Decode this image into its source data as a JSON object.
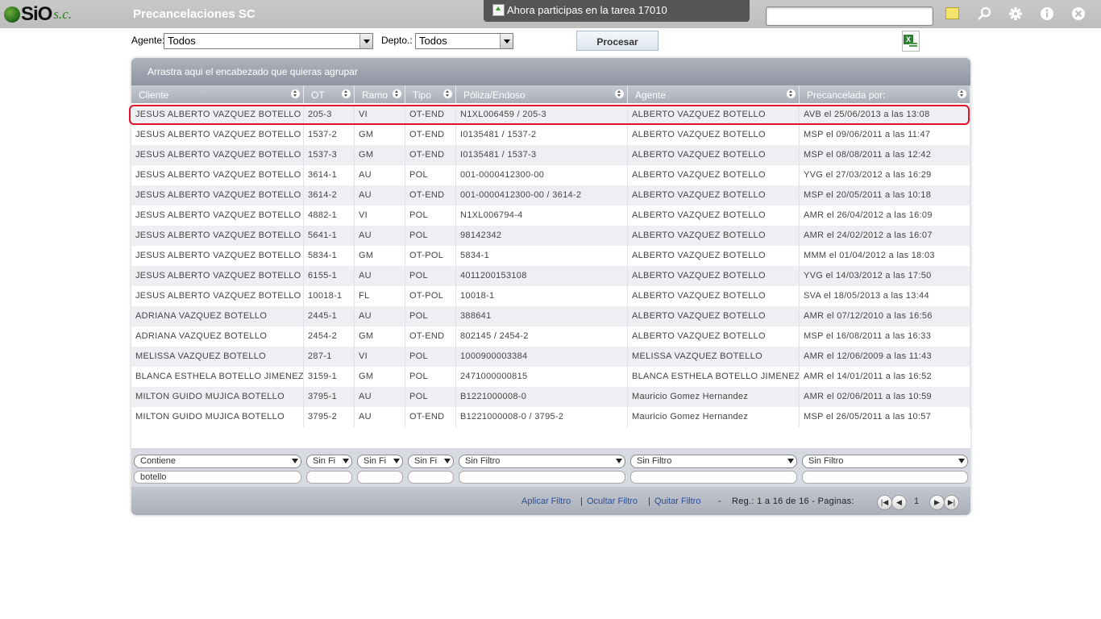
{
  "app": {
    "logo_text": "SiO",
    "logo_suffix": "s.c.",
    "title": "Precancelaciones SC",
    "notification": "Ahora participas en la tarea 17010",
    "search_placeholder": ""
  },
  "icons": [
    "note-icon",
    "search-icon",
    "gear-icon",
    "info-icon",
    "close-icon"
  ],
  "filters": {
    "agente_label": "Agente:",
    "agente_value": "Todos",
    "depto_label": "Depto.:",
    "depto_value": "Todos",
    "procesar_label": "Procesar"
  },
  "grid": {
    "group_hint": "Arrastra aqui el encabezado que quieras agrupar",
    "columns": [
      "Cliente",
      "OT",
      "Ramo",
      "Tipo",
      "Póliza/Endoso",
      "Agente",
      "Precancelada por:"
    ],
    "rows": [
      [
        "JESUS ALBERTO VAZQUEZ BOTELLO",
        "205-3",
        "VI",
        "OT-END",
        "N1XL006459 / 205-3",
        "ALBERTO VAZQUEZ BOTELLO",
        "AVB el 25/06/2013 a las 13:08"
      ],
      [
        "JESUS ALBERTO VAZQUEZ BOTELLO",
        "1537-2",
        "GM",
        "OT-END",
        "I0135481 / 1537-2",
        "ALBERTO VAZQUEZ BOTELLO",
        "MSP el 09/06/2011 a las 11:47"
      ],
      [
        "JESUS ALBERTO VAZQUEZ BOTELLO",
        "1537-3",
        "GM",
        "OT-END",
        "I0135481 / 1537-3",
        "ALBERTO VAZQUEZ BOTELLO",
        "MSP el 08/08/2011 a las 12:42"
      ],
      [
        "JESUS ALBERTO VAZQUEZ BOTELLO",
        "3614-1",
        "AU",
        "POL",
        "001-0000412300-00",
        "ALBERTO VAZQUEZ BOTELLO",
        "YVG el 27/03/2012 a las 16:29"
      ],
      [
        "JESUS ALBERTO VAZQUEZ BOTELLO",
        "3614-2",
        "AU",
        "OT-END",
        "001-0000412300-00 / 3614-2",
        "ALBERTO VAZQUEZ BOTELLO",
        "MSP el 20/05/2011 a las 10:18"
      ],
      [
        "JESUS ALBERTO VAZQUEZ BOTELLO",
        "4882-1",
        "VI",
        "POL",
        "N1XL006794-4",
        "ALBERTO VAZQUEZ BOTELLO",
        "AMR el 26/04/2012 a las 16:09"
      ],
      [
        "JESUS ALBERTO VAZQUEZ BOTELLO",
        "5641-1",
        "AU",
        "POL",
        "98142342",
        "ALBERTO VAZQUEZ BOTELLO",
        "AMR el 24/02/2012 a las 16:07"
      ],
      [
        "JESUS ALBERTO VAZQUEZ BOTELLO",
        "5834-1",
        "GM",
        "OT-POL",
        "5834-1",
        "ALBERTO VAZQUEZ BOTELLO",
        "MMM el 01/04/2012 a las 18:03"
      ],
      [
        "JESUS ALBERTO VAZQUEZ BOTELLO",
        "6155-1",
        "AU",
        "POL",
        "4011200153108",
        "ALBERTO VAZQUEZ BOTELLO",
        "YVG el 14/03/2012 a las 17:50"
      ],
      [
        "JESUS ALBERTO VAZQUEZ BOTELLO",
        "10018-1",
        "FL",
        "OT-POL",
        "10018-1",
        "ALBERTO VAZQUEZ BOTELLO",
        "SVA el 18/05/2013 a las 13:44"
      ],
      [
        "ADRIANA VAZQUEZ BOTELLO",
        "2445-1",
        "AU",
        "POL",
        "388641",
        "ALBERTO VAZQUEZ BOTELLO",
        "AMR el 07/12/2010 a las 16:56"
      ],
      [
        "ADRIANA VAZQUEZ BOTELLO",
        "2454-2",
        "GM",
        "OT-END",
        "802145 / 2454-2",
        "ALBERTO VAZQUEZ BOTELLO",
        "MSP el 16/08/2011 a las 16:33"
      ],
      [
        "MELISSA VAZQUEZ BOTELLO",
        "287-1",
        "VI",
        "POL",
        "1000900003384",
        "MELISSA VAZQUEZ BOTELLO",
        "AMR el 12/06/2009 a las 11:43"
      ],
      [
        "BLANCA ESTHELA BOTELLO JIMENEZ",
        "3159-1",
        "GM",
        "POL",
        "2471000000815",
        "BLANCA ESTHELA BOTELLO JIMENEZ",
        "AMR el 14/01/2011 a las 16:52"
      ],
      [
        "MILTON GUIDO MUJICA BOTELLO",
        "3795-1",
        "AU",
        "POL",
        "B1221000008-0",
        "Mauricio Gomez Hernandez",
        "AMR el 02/06/2011 a las 10:59"
      ],
      [
        "MILTON GUIDO MUJICA BOTELLO",
        "3795-2",
        "AU",
        "OT-END",
        "B1221000008-0 / 3795-2",
        "Mauricio Gomez Hernandez",
        "MSP el 26/05/2011 a las 10:57"
      ]
    ],
    "filter_ops": [
      "Contiene",
      "Sin Fi",
      "Sin Fi",
      "Sin Fi",
      "Sin Filtro",
      "Sin Filtro",
      "Sin Filtro"
    ],
    "filter_values": [
      "botello",
      "",
      "",
      "",
      "",
      "",
      ""
    ]
  },
  "footer": {
    "apply_filter": "Aplicar Filtro",
    "hide_filter": "Ocultar Filtro",
    "remove_filter": "Quitar Filtro",
    "sep": "|",
    "dash": "-",
    "records": "Reg.: 1 a 16 de 16 - Paginas:",
    "page": "1"
  },
  "colors": {
    "highlight": "#e0152c",
    "link": "#2a4f9a",
    "header": "#a8adb8"
  }
}
